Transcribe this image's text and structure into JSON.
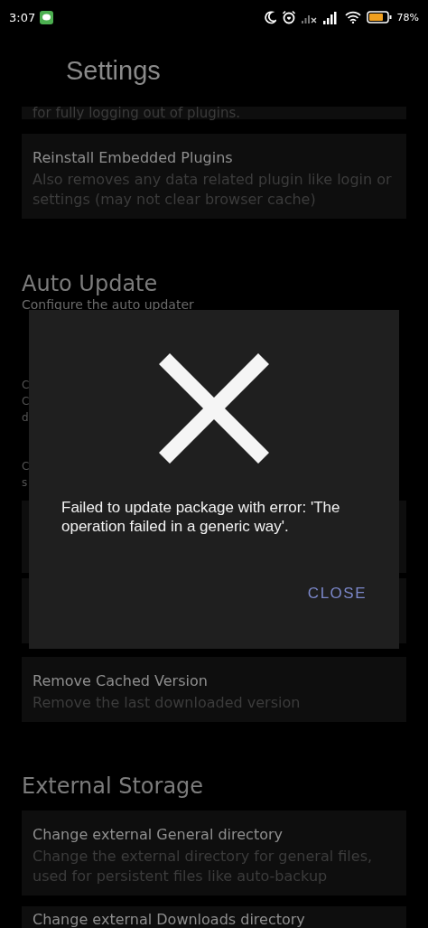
{
  "status_bar": {
    "time": "3:07",
    "battery": "78%"
  },
  "header": {
    "title": "Settings"
  },
  "top_cards": [
    {
      "kind": "partial",
      "description": "for fully logging out of plugins."
    },
    {
      "kind": "full",
      "title": "Reinstall Embedded Plugins",
      "description": "Also removes any data related plugin like login or settings (may not clear browser cache)"
    }
  ],
  "auto_update": {
    "heading": "Auto Update",
    "subheading": "Configure the auto updater",
    "covered_lines": [
      {
        "kind": "line",
        "text": "C"
      },
      {
        "kind": "line",
        "text": "C"
      },
      {
        "kind": "line",
        "text": "d"
      },
      {
        "kind": "line",
        "text": "C"
      },
      {
        "kind": "line",
        "text": "s"
      }
    ],
    "cards": [
      {
        "title": "Remove Cached Version",
        "description": "Remove the last downloaded version"
      }
    ]
  },
  "external_storage": {
    "heading": "External Storage",
    "cards": [
      {
        "title": "Change external General directory",
        "description": "Change the external directory for general files, used for persistent files like auto-backup"
      },
      {
        "title": "Change external Downloads directory"
      }
    ]
  },
  "dialog": {
    "message": "Failed to update package with error: 'The operation failed in a generic way'.",
    "button": "CLOSE"
  }
}
